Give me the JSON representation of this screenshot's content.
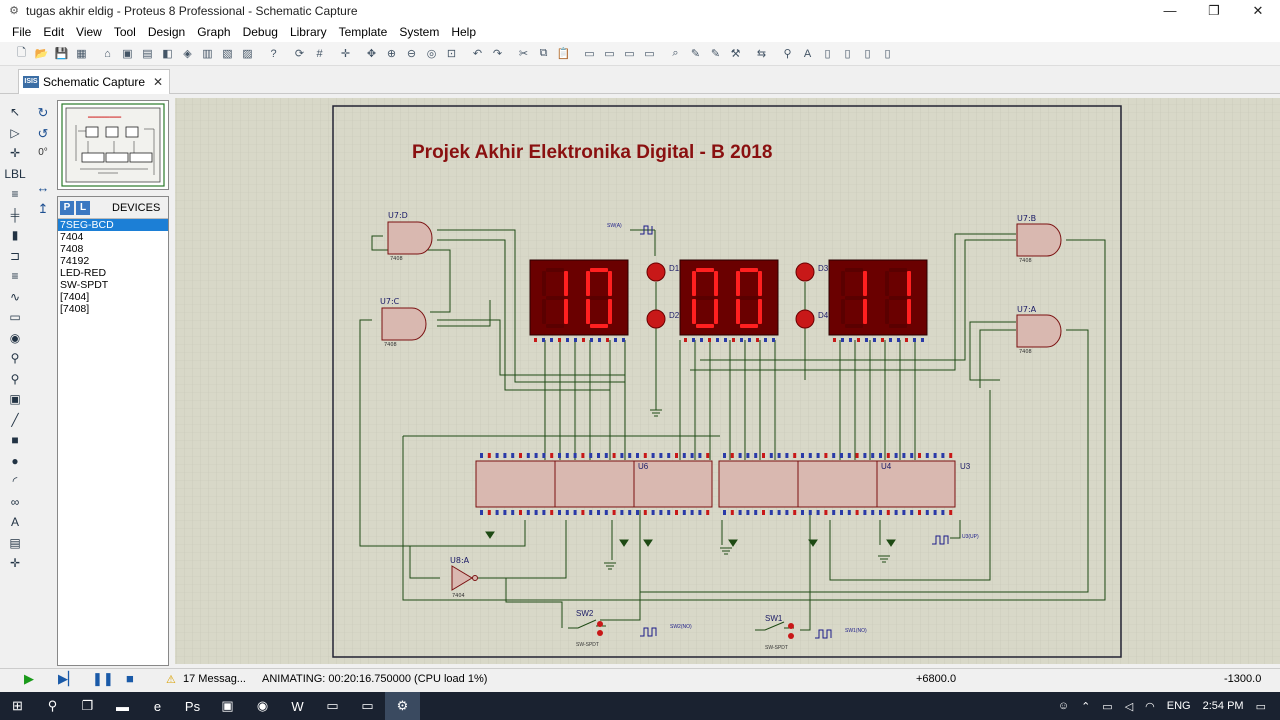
{
  "window": {
    "title": "tugas akhir eldig - Proteus 8 Professional - Schematic Capture",
    "minimize": "—",
    "restore": "❐",
    "close": "✕"
  },
  "menu": [
    "File",
    "Edit",
    "View",
    "Tool",
    "Design",
    "Graph",
    "Debug",
    "Library",
    "Template",
    "System",
    "Help"
  ],
  "tab": {
    "icon": "ISIS",
    "label": "Schematic Capture",
    "close": "✕"
  },
  "devices": {
    "header": "DEVICES",
    "p_btn": "P",
    "l_btn": "L",
    "items": [
      "7SEG-BCD",
      "7404",
      "7408",
      "74192",
      "LED-RED",
      "SW-SPDT",
      "[7404]",
      "[7408]"
    ],
    "selected": 0
  },
  "rotation": {
    "angle": "0°"
  },
  "schematic": {
    "title": "Projek Akhir Elektronika Digital - B 2018",
    "displays": [
      {
        "digits": "10"
      },
      {
        "digits": "00"
      },
      {
        "digits": "11"
      }
    ],
    "leds": [
      "D1",
      "D2",
      "D3",
      "D4"
    ],
    "gates": {
      "u7d": "U7:D",
      "u7c": "U7:C",
      "u7b": "U7:B",
      "u7a": "U7:A",
      "u8a": "U8:A",
      "chip_7408": "7408",
      "chip_7404": "7404"
    },
    "counters": [
      "U6",
      "U4",
      "U3"
    ],
    "switches": {
      "sw2": "SW2",
      "sw1": "SW1",
      "sw_type": "SW-SPDT",
      "sw2_gen": "SW2(NO)",
      "sw1_gen": "SW1(NO)",
      "clk_gen": "U3(UP)",
      "sw_a": "SW(A)"
    }
  },
  "status": {
    "messages": "17 Messag...",
    "animating": "ANIMATING: 00:20:16.750000 (CPU load 1%)",
    "coord_x": "+6800.0",
    "coord_y": "-1300.0"
  },
  "taskbar": {
    "lang": "ENG",
    "time": "2:54 PM"
  },
  "colors": {
    "segment_on": "#ff2020",
    "segment_off": "#5a0000",
    "display_bg": "#6a0000",
    "wire": "#1e4a14",
    "chip_fill": "#d9b8b0",
    "sheet": "#d8d8c8",
    "selection": "#1c7fd6"
  }
}
